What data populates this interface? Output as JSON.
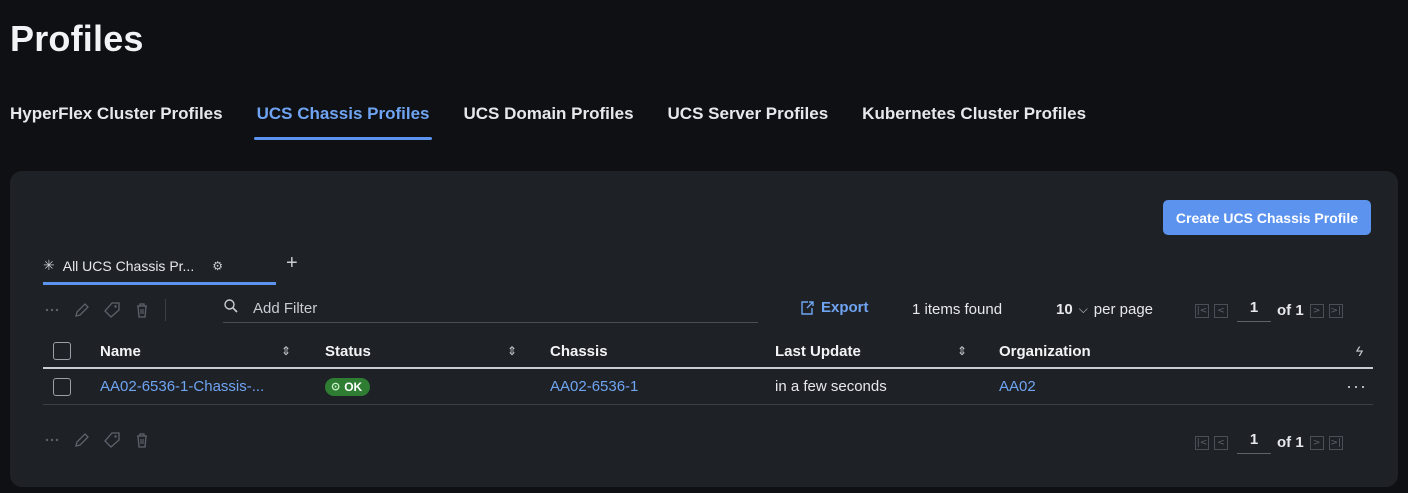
{
  "page": {
    "title": "Profiles"
  },
  "tabs": [
    {
      "label": "HyperFlex Cluster Profiles",
      "active": false
    },
    {
      "label": "UCS Chassis Profiles",
      "active": true
    },
    {
      "label": "UCS Domain Profiles",
      "active": false
    },
    {
      "label": "UCS Server Profiles",
      "active": false
    },
    {
      "label": "Kubernetes Cluster Profiles",
      "active": false
    }
  ],
  "actions": {
    "create_label": "Create UCS Chassis Profile"
  },
  "view_tab": {
    "label": "All UCS Chassis Pr...",
    "add_icon": "plus-icon",
    "settings_icon": "gear-icon"
  },
  "toolbar": {
    "icons": [
      "more-icon",
      "edit-icon",
      "tag-icon",
      "delete-icon"
    ],
    "filter_placeholder": "Add Filter",
    "export_label": "Export",
    "items_found": "1 items found",
    "per_page_value": "10",
    "per_page_label": "per page",
    "page_number": "1",
    "page_of": "of 1"
  },
  "table": {
    "columns": [
      "Name",
      "Status",
      "Chassis",
      "Last Update",
      "Organization"
    ],
    "rows": [
      {
        "name": "AA02-6536-1-Chassis-...",
        "status": "OK",
        "chassis": "AA02-6536-1",
        "last_update": "in a few seconds",
        "organization": "AA02"
      }
    ]
  },
  "colors": {
    "accent": "#5b93ef",
    "link": "#6fa4f2",
    "ok": "#2e7d32",
    "background": "#0f1013",
    "card": "#1e2126"
  }
}
